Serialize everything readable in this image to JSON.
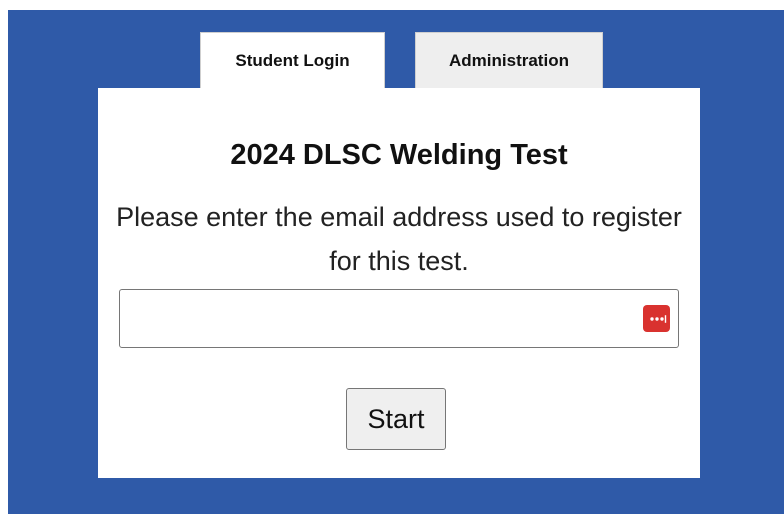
{
  "page_top_fragment": "",
  "tabs": [
    {
      "label": "Student Login",
      "active": true
    },
    {
      "label": "Administration",
      "active": false
    }
  ],
  "card": {
    "title": "2024 DLSC Welding Test",
    "message": "Please enter the email address used to register for this test.",
    "email_value": "",
    "email_placeholder": "",
    "start_label": "Start"
  },
  "colors": {
    "panel_background": "#2f5aa8",
    "card_background": "#ffffff",
    "password_manager_icon": "#d9322f"
  },
  "icons": {
    "password_manager": "password-manager-icon"
  }
}
